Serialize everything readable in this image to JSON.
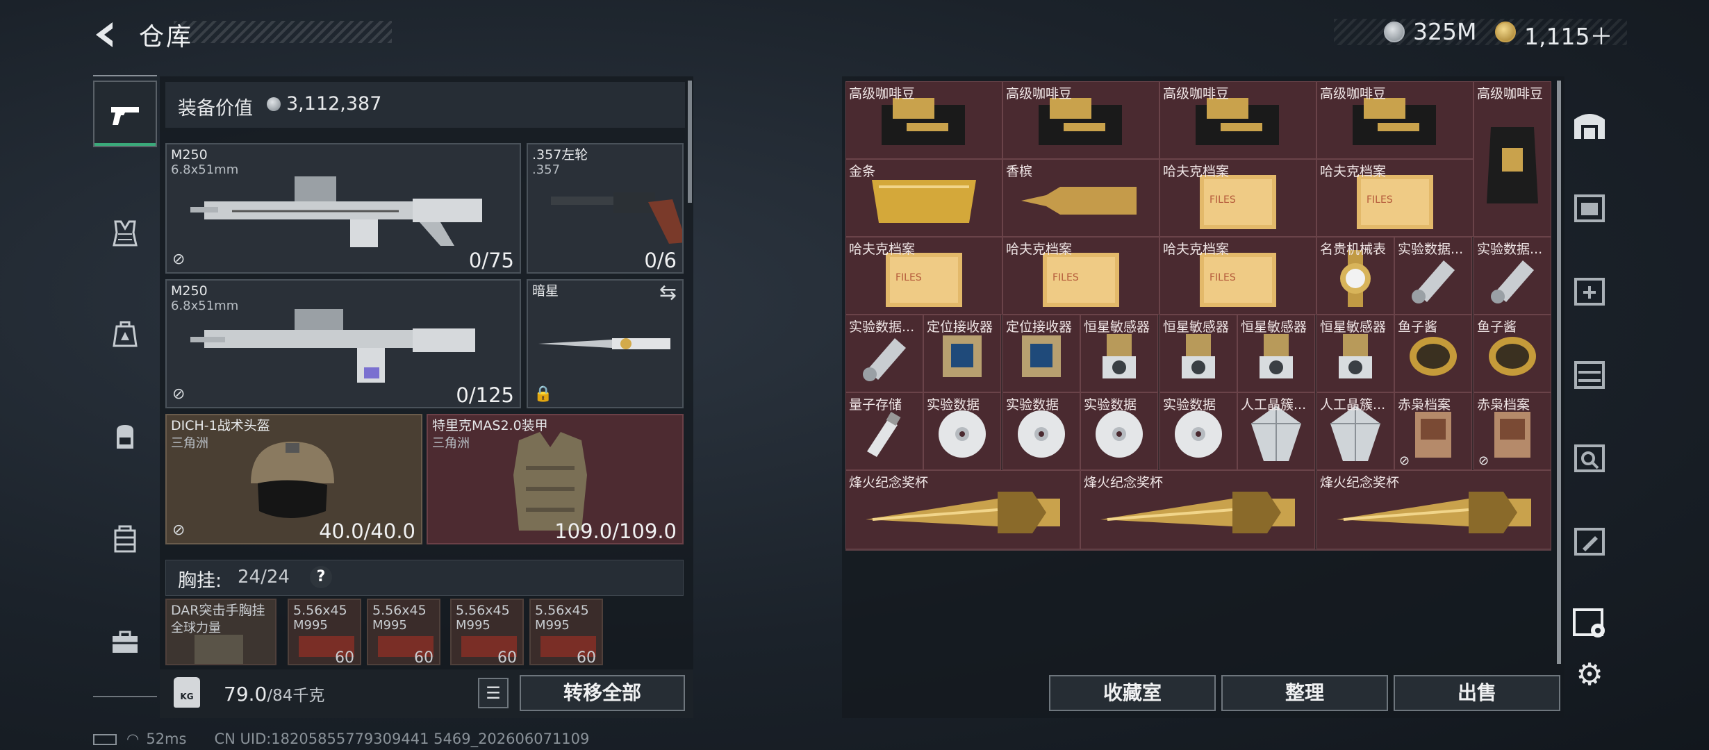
{
  "header": {
    "title": "仓库"
  },
  "currency": {
    "silver": "325M",
    "gold": "1,115＋"
  },
  "left_nav": {
    "items": [
      {
        "name": "tab-weapons",
        "icon": "pistol-icon"
      },
      {
        "name": "tab-armor",
        "icon": "vest-icon"
      },
      {
        "name": "tab-medical",
        "icon": "medkit-icon"
      },
      {
        "name": "tab-backpack",
        "icon": "backpack-icon"
      },
      {
        "name": "tab-rig",
        "icon": "rig-icon"
      },
      {
        "name": "tab-case",
        "icon": "briefcase-icon"
      }
    ]
  },
  "equip": {
    "value_label": "装备价值",
    "value": "3,112,387",
    "primary1": {
      "name": "M250",
      "ammo": "6.8x51mm",
      "count": "0/75"
    },
    "sidearm": {
      "name": ".357左轮",
      "ammo": ".357",
      "count": "0/6"
    },
    "primary2": {
      "name": "M250",
      "ammo": "6.8x51mm",
      "count": "0/125"
    },
    "melee": {
      "name": "暗星"
    },
    "helmet": {
      "name": "DICH-1战术头盔",
      "maker": "三角洲",
      "count": "40.0/40.0"
    },
    "armor": {
      "name": "特里克MAS2.0装甲",
      "maker": "三角洲",
      "count": "109.0/109.0"
    },
    "chest": {
      "label": "胸挂:",
      "count": "24/24",
      "help": "?"
    },
    "rig": {
      "name": "DAR突击手胸挂",
      "maker": "全球力量"
    },
    "ammo_slots": [
      {
        "name": "5.56x45",
        "type": "M995",
        "count": "60"
      },
      {
        "name": "5.56x45",
        "type": "M995",
        "count": "60"
      },
      {
        "name": "5.56x45",
        "type": "M995",
        "count": "60"
      },
      {
        "name": "5.56x45",
        "type": "M995",
        "count": "60"
      }
    ],
    "weight": "79.0",
    "weight_max": "/84千克",
    "weight_icon": "KG",
    "transfer": "转移全部"
  },
  "storage": {
    "items": [
      {
        "label": "高级咖啡豆",
        "kind": "coffee"
      },
      {
        "label": "高级咖啡豆",
        "kind": "coffee"
      },
      {
        "label": "高级咖啡豆",
        "kind": "coffee"
      },
      {
        "label": "高级咖啡豆",
        "kind": "coffee"
      },
      {
        "label": "高级咖啡豆",
        "kind": "coffee-bag"
      },
      {
        "label": "金条",
        "kind": "gold"
      },
      {
        "label": "香槟",
        "kind": "champagne"
      },
      {
        "label": "哈夫克档案",
        "kind": "files"
      },
      {
        "label": "哈夫克档案",
        "kind": "files"
      },
      {
        "label": "哈夫克档案",
        "kind": "files"
      },
      {
        "label": "哈夫克档案",
        "kind": "files"
      },
      {
        "label": "哈夫克档案",
        "kind": "files"
      },
      {
        "label": "名贵机械表",
        "kind": "watch"
      },
      {
        "label": "实验数据...",
        "kind": "canister"
      },
      {
        "label": "实验数据...",
        "kind": "canister"
      },
      {
        "label": "实验数据...",
        "kind": "canister"
      },
      {
        "label": "定位接收器",
        "kind": "receiver"
      },
      {
        "label": "定位接收器",
        "kind": "receiver"
      },
      {
        "label": "恒星敏感器",
        "kind": "sensor"
      },
      {
        "label": "恒星敏感器",
        "kind": "sensor"
      },
      {
        "label": "恒星敏感器",
        "kind": "sensor"
      },
      {
        "label": "恒星敏感器",
        "kind": "sensor"
      },
      {
        "label": "鱼子酱",
        "kind": "caviar"
      },
      {
        "label": "鱼子酱",
        "kind": "caviar"
      },
      {
        "label": "量子存储",
        "kind": "usb"
      },
      {
        "label": "实验数据",
        "kind": "disc"
      },
      {
        "label": "实验数据",
        "kind": "disc"
      },
      {
        "label": "实验数据",
        "kind": "disc"
      },
      {
        "label": "实验数据",
        "kind": "disc"
      },
      {
        "label": "人工晶簇...",
        "kind": "crystal"
      },
      {
        "label": "人工晶簇...",
        "kind": "crystal"
      },
      {
        "label": "赤枭档案",
        "kind": "owlfile"
      },
      {
        "label": "赤枭档案",
        "kind": "owlfile"
      },
      {
        "label": "烽火纪念奖杯",
        "kind": "trophy"
      },
      {
        "label": "烽火纪念奖杯",
        "kind": "trophy"
      },
      {
        "label": "烽火纪念奖杯",
        "kind": "trophy"
      }
    ]
  },
  "actions": {
    "collection": "收藏室",
    "organize": "整理",
    "sell": "出售"
  },
  "right_nav": {
    "items": [
      {
        "name": "storage-main-tab",
        "icon": "warehouse-icon"
      },
      {
        "name": "storage-tab-2",
        "icon": "storage-box-icon"
      },
      {
        "name": "storage-tab-3",
        "icon": "storage-add-icon"
      },
      {
        "name": "storage-tab-4",
        "icon": "storage-shelf-icon"
      },
      {
        "name": "storage-tab-5",
        "icon": "storage-search-icon"
      },
      {
        "name": "storage-tab-6",
        "icon": "storage-edit-icon"
      },
      {
        "name": "storage-tab-7",
        "icon": "storage-settings-icon"
      }
    ]
  },
  "status": {
    "ping": "52ms",
    "uid": "CN UID:18205855779309441 5469_202606071109"
  }
}
